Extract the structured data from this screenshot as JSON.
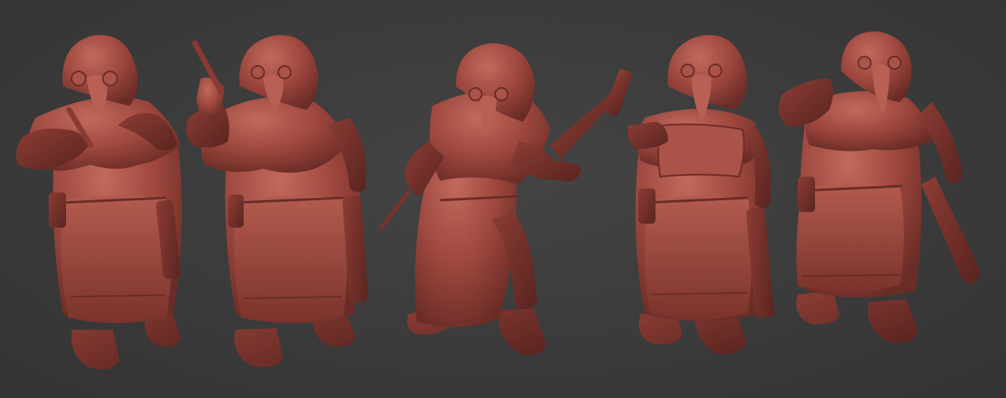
{
  "scene": {
    "subject": "plague-doctor-miniature-sculpts",
    "figure_count": 5,
    "background_color": "#3a3a3a",
    "clay_color": "#a4483f",
    "clay_shadow_color": "#5e2621",
    "clay_highlight_color": "#c56a5e"
  },
  "figures": [
    {
      "pose": "holding-syringe-both-hands",
      "held_item": "syringe"
    },
    {
      "pose": "syringe-raised-pistol-lowered",
      "held_item": "syringe-and-pistol"
    },
    {
      "pose": "dagger-left-pistol-aimed-right",
      "held_item": "dagger-and-pistol"
    },
    {
      "pose": "holding-scroll-pistol-lowered",
      "held_item": "scroll-and-pistol"
    },
    {
      "pose": "adjusting-goggles-pistol-lowered",
      "held_item": "pistol"
    }
  ]
}
